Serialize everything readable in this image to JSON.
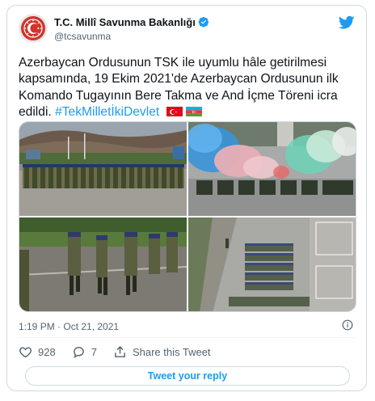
{
  "author": {
    "name": "T.C. Millî Savunma Bakanlığı",
    "handle": "@tcsavunma",
    "avatar_icon": "msb-emblem-icon",
    "verified_icon": "verified-badge-icon"
  },
  "tweet": {
    "text_main": "Azerbaycan Ordusunun TSK ile uyumlu hâle getirilmesi kapsamında, 19 Ekim 2021'de Azerbaycan Ordusunun ilk Komando Tugayının Bere Takma ve And İçme Töreni icra edildi. ",
    "hashtag": "#TekMilletİkiDevlet",
    "flags": [
      "turkey-flag-icon",
      "azerbaijan-flag-icon"
    ],
    "media": [
      "photo-soldiers-lined-up",
      "photo-aerial-colored-smoke",
      "photo-soldiers-marching",
      "photo-aerial-formation"
    ],
    "timestamp": "1:19 PM · Oct 21, 2021"
  },
  "actions": {
    "likes": "928",
    "replies": "7",
    "share_label": "Share this Tweet"
  },
  "reply_button_label": "Tweet your reply",
  "colors": {
    "accent": "#1d9bf0",
    "text": "#0f1419",
    "muted": "#536471",
    "border": "#cfd9de",
    "avatar_red": "#d0342c"
  }
}
